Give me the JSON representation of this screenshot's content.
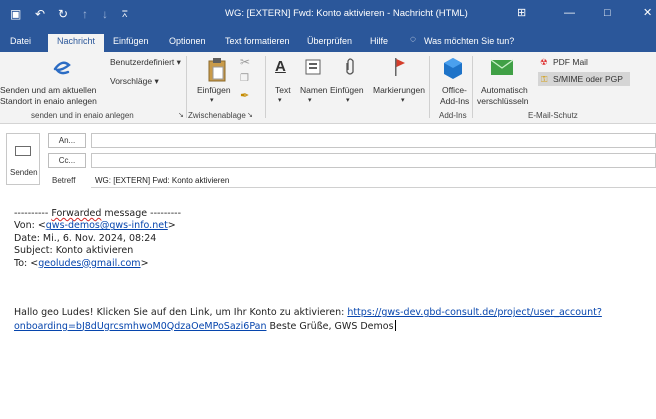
{
  "titlebar": {
    "title": "WG: [EXTERN] Fwd: Konto aktivieren  -  Nachricht (HTML)",
    "icons": [
      "save-icon",
      "undo-icon",
      "redo-icon",
      "up-arrow-icon",
      "down-arrow-icon",
      "customize-qat-icon"
    ],
    "window_controls": [
      "ribbon-display-icon",
      "minimize-icon",
      "maximize-icon",
      "close-icon"
    ]
  },
  "tabs": [
    "Datei",
    "Nachricht",
    "Einfügen",
    "Optionen",
    "Text formatieren",
    "Überprüfen",
    "Hilfe"
  ],
  "tell_me": "Was möchten Sie tun?",
  "ribbon": {
    "send_group": {
      "line1": "Senden und am aktuellen",
      "line2": "Standort in enaio anlegen",
      "label": "senden und in enaio anlegen"
    },
    "benutzerdefiniert": "Benutzerdefiniert",
    "vorschlaege": "Vorschläge",
    "clipboard_paste": "Einfügen",
    "clipboard_label": "Zwischenablage",
    "text": "Text",
    "namen": "Namen",
    "einfuegen2": "Einfügen",
    "markierungen": "Markierungen",
    "office_addins_1": "Office-",
    "office_addins_2": "Add-Ins",
    "addins_label": "Add-Ins",
    "auto_encrypt_1": "Automatisch",
    "auto_encrypt_2": "verschlüsseln",
    "pdf_mail": "PDF Mail",
    "smime": "S/MIME oder PGP",
    "email_security_label": "E-Mail-Schutz"
  },
  "header": {
    "send_label": "Senden",
    "an": "An...",
    "cc": "Cc...",
    "betreff_label": "Betreff",
    "subject": "WG: [EXTERN] Fwd: Konto aktivieren"
  },
  "body": {
    "fwd_prefix": "---------- ",
    "fwd_word": "Forwarded",
    "fwd_suffix": " message ---------",
    "von_label": "Von: <",
    "von_email": "gws-demos@gws-info.net",
    "von_end": ">",
    "date": "Date: Mi., 6. Nov. 2024, 08:24",
    "subject": "Subject: Konto aktivieren",
    "to_label": "To: <",
    "to_email": "geoludes@gmail.com",
    "to_end": ">",
    "msg_intro": "Hallo geo Ludes! Klicken Sie auf den Link, um Ihr Konto zu aktivieren: ",
    "link_part1": "https://gws-dev.gbd-consult.de/project/user_account?",
    "link_part2": "onboarding=bJ8dUgrcsmhwoM0QdzaOeMPoSazi6Pan",
    "closing": " Beste Grüße, GWS Demos"
  }
}
